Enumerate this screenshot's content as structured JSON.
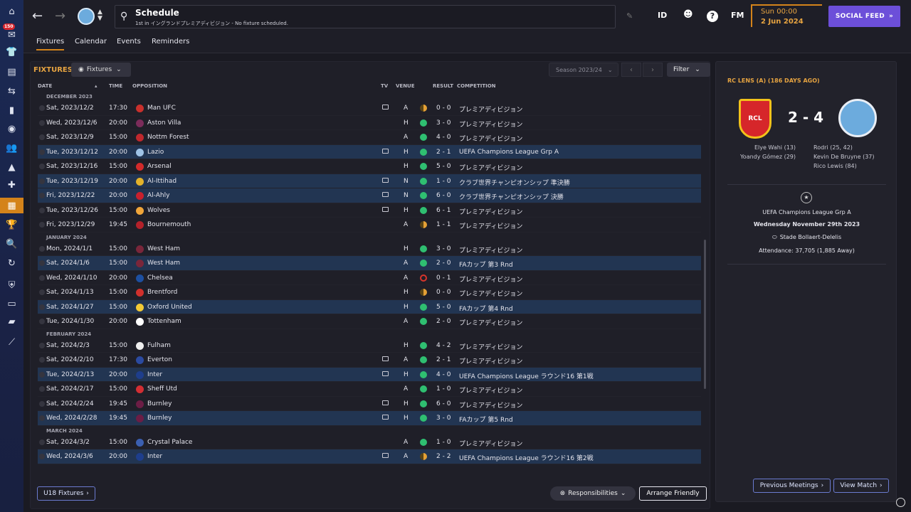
{
  "top": {
    "badge": "150",
    "title": "Schedule",
    "subtitle": "1st in イングランドプレミアディビジョン - No fixture scheduled.",
    "id_label": "ID",
    "fm_label": "FM",
    "help": "?",
    "time": "Sun 00:00",
    "date": "2 Jun 2024",
    "social": "SOCIAL FEED"
  },
  "tabs": [
    "Fixtures",
    "Calendar",
    "Events",
    "Reminders"
  ],
  "fixtures": {
    "title": "FIXTURES",
    "dropdown": "Fixtures",
    "season": "Season 2023/24",
    "filter": "Filter",
    "headers": {
      "date": "DATE",
      "time": "TIME",
      "opp": "OPPOSITION",
      "tv": "TV",
      "venue": "VENUE",
      "result": "RESULT",
      "comp": "COMPETITION"
    },
    "months": [
      "DECEMBER 2023",
      "JANUARY 2024",
      "FEBRUARY 2024",
      "MARCH 2024"
    ],
    "rows": [
      {
        "date": "Sat, 2023/12/2",
        "time": "17:30",
        "opp": "Man UFC",
        "venue": "A",
        "score": "0 - 0",
        "comp": "プレミアディビジョン"
      },
      {
        "date": "Wed, 2023/12/6",
        "time": "20:00",
        "opp": "Aston Villa",
        "venue": "H",
        "score": "3 - 0",
        "comp": "プレミアディビジョン"
      },
      {
        "date": "Sat, 2023/12/9",
        "time": "15:00",
        "opp": "Nottm Forest",
        "venue": "A",
        "score": "4 - 0",
        "comp": "プレミアディビジョン"
      },
      {
        "date": "Tue, 2023/12/12",
        "time": "20:00",
        "opp": "Lazio",
        "venue": "H",
        "score": "2 - 1",
        "comp": "UEFA Champions League Grp A"
      },
      {
        "date": "Sat, 2023/12/16",
        "time": "15:00",
        "opp": "Arsenal",
        "venue": "H",
        "score": "5 - 0",
        "comp": "プレミアディビジョン"
      },
      {
        "date": "Tue, 2023/12/19",
        "time": "20:00",
        "opp": "Al-Ittihad",
        "venue": "N",
        "score": "1 - 0",
        "comp": "クラブ世界チャンピオンシップ 準決勝"
      },
      {
        "date": "Fri, 2023/12/22",
        "time": "20:00",
        "opp": "Al-Ahly",
        "venue": "N",
        "score": "6 - 0",
        "comp": "クラブ世界チャンピオンシップ 決勝"
      },
      {
        "date": "Tue, 2023/12/26",
        "time": "15:00",
        "opp": "Wolves",
        "venue": "H",
        "score": "6 - 1",
        "comp": "プレミアディビジョン"
      },
      {
        "date": "Fri, 2023/12/29",
        "time": "19:45",
        "opp": "Bournemouth",
        "venue": "A",
        "score": "1 - 1",
        "comp": "プレミアディビジョン"
      },
      {
        "date": "Mon, 2024/1/1",
        "time": "15:00",
        "opp": "West Ham",
        "venue": "H",
        "score": "3 - 0",
        "comp": "プレミアディビジョン"
      },
      {
        "date": "Sat, 2024/1/6",
        "time": "15:00",
        "opp": "West Ham",
        "venue": "A",
        "score": "2 - 0",
        "comp": "FAカップ 第3 Rnd"
      },
      {
        "date": "Wed, 2024/1/10",
        "time": "20:00",
        "opp": "Chelsea",
        "venue": "A",
        "score": "0 - 1",
        "comp": "プレミアディビジョン"
      },
      {
        "date": "Sat, 2024/1/13",
        "time": "15:00",
        "opp": "Brentford",
        "venue": "H",
        "score": "0 - 0",
        "comp": "プレミアディビジョン"
      },
      {
        "date": "Sat, 2024/1/27",
        "time": "15:00",
        "opp": "Oxford United",
        "venue": "H",
        "score": "5 - 0",
        "comp": "FAカップ 第4 Rnd"
      },
      {
        "date": "Tue, 2024/1/30",
        "time": "20:00",
        "opp": "Tottenham",
        "venue": "A",
        "score": "2 - 0",
        "comp": "プレミアディビジョン"
      },
      {
        "date": "Sat, 2024/2/3",
        "time": "15:00",
        "opp": "Fulham",
        "venue": "H",
        "score": "4 - 2",
        "comp": "プレミアディビジョン"
      },
      {
        "date": "Sat, 2024/2/10",
        "time": "17:30",
        "opp": "Everton",
        "venue": "A",
        "score": "2 - 1",
        "comp": "プレミアディビジョン"
      },
      {
        "date": "Tue, 2024/2/13",
        "time": "20:00",
        "opp": "Inter",
        "venue": "H",
        "score": "4 - 0",
        "comp": "UEFA Champions League ラウンド16 第1戦"
      },
      {
        "date": "Sat, 2024/2/17",
        "time": "15:00",
        "opp": "Sheff Utd",
        "venue": "A",
        "score": "1 - 0",
        "comp": "プレミアディビジョン"
      },
      {
        "date": "Sat, 2024/2/24",
        "time": "19:45",
        "opp": "Burnley",
        "venue": "H",
        "score": "6 - 0",
        "comp": "プレミアディビジョン"
      },
      {
        "date": "Wed, 2024/2/28",
        "time": "19:45",
        "opp": "Burnley",
        "venue": "H",
        "score": "3 - 0",
        "comp": "FAカップ 第5 Rnd"
      },
      {
        "date": "Sat, 2024/3/2",
        "time": "15:00",
        "opp": "Crystal Palace",
        "venue": "A",
        "score": "1 - 0",
        "comp": "プレミアディビジョン"
      },
      {
        "date": "Wed, 2024/3/6",
        "time": "20:00",
        "opp": "Inter",
        "venue": "A",
        "score": "2 - 2",
        "comp": "UEFA Champions League ラウンド16 第2戦"
      }
    ],
    "u18": "U18 Fixtures",
    "responsibilities": "Responsibilities",
    "arrange": "Arrange Friendly"
  },
  "side": {
    "title": "RC LENS (A) (186 DAYS AGO)",
    "lens_crest_text": "RCL",
    "score": "2 - 4",
    "home_scorers": [
      "Elye Wahi (13)",
      "Yoandy Gómez (29)"
    ],
    "away_scorers": [
      "Rodri (25, 42)",
      "Kevin De Bruyne (37)",
      "Rico Lewis (84)"
    ],
    "competition": "UEFA Champions League Grp A",
    "date": "Wednesday November 29th 2023",
    "stadium": "Stade Bollaert-Delelis",
    "attendance": "Attendance: 37,705 (1,885 Away)",
    "prev": "Previous Meetings",
    "view": "View Match"
  },
  "colors": {
    "accent": "#d4831a",
    "social": "#6c4fd9",
    "win": "#2fbf71",
    "draw": "#e4a035",
    "loss": "#d8352b",
    "highlight_row": "#223552"
  }
}
